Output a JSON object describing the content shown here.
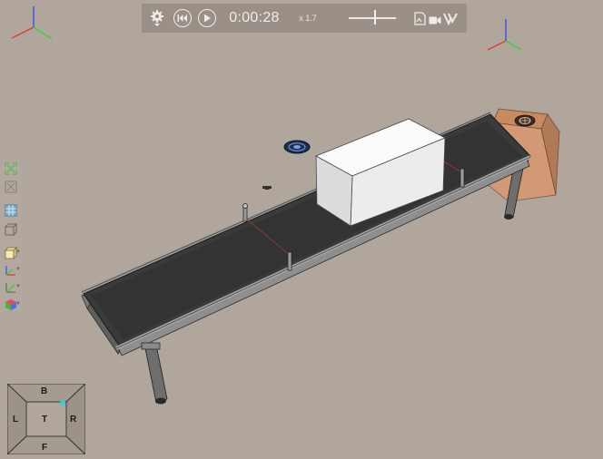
{
  "toolbar": {
    "settings_icon": "gear-icon",
    "rewind_icon": "rewind-icon",
    "play_icon": "play-icon",
    "time": "0:00:28",
    "speed_label": "x  1.7",
    "speed_value": 1.7,
    "snapshot_icon": "image-export-icon",
    "record_icon": "video-camera-icon",
    "logo_icon": "brand-logo-icon"
  },
  "sidebar": {
    "items": [
      {
        "name": "fit-all-icon"
      },
      {
        "name": "fit-selection-icon"
      },
      {
        "name": "grid-icon"
      },
      {
        "name": "perspective-icon"
      },
      {
        "name": "view-mode-icon"
      },
      {
        "name": "axis-display-icon"
      },
      {
        "name": "measure-icon"
      },
      {
        "name": "render-mode-icon"
      }
    ]
  },
  "viewcube": {
    "top": "B",
    "left": "L",
    "center": "T",
    "right": "R",
    "bottom": "F"
  },
  "colors": {
    "background": "#b1a69b",
    "belt": "#3a3a3a",
    "frame": "#8e8e8e",
    "box": "#f2f2f2",
    "enclosure": "#d9976e",
    "axis_x": "#e63a3a",
    "axis_y": "#3ad13a",
    "axis_z": "#3a5ae6",
    "viewcube_marker": "#27d7d2"
  }
}
